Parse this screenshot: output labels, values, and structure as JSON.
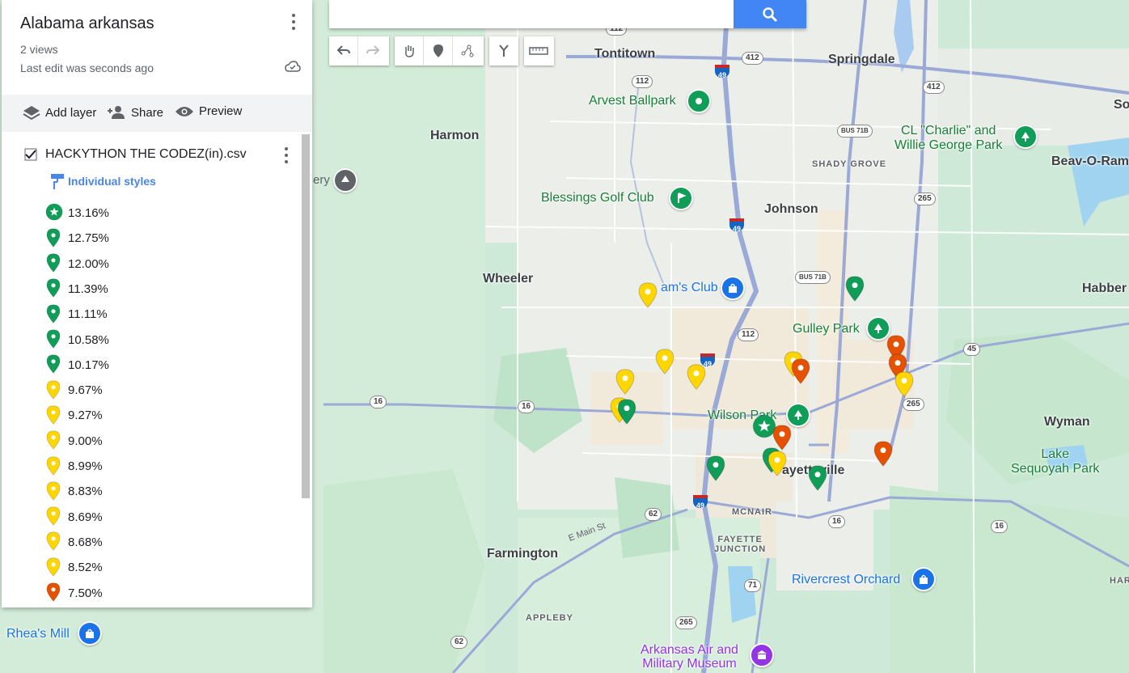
{
  "map": {
    "town_labels": [
      "Tontitown",
      "Springdale",
      "Harmon",
      "Johnson",
      "Wheeler",
      "Farmington",
      "Wyman",
      "Habber",
      "Beav-O-Ram",
      "So"
    ],
    "neighborhood_labels": [
      "SHADY GROVE",
      "MCNAIR",
      "FAYETTE\nJUNCTION",
      "APPLEBY",
      "HAR"
    ],
    "poi_labels": {
      "arvest": "Arvest Ballpark",
      "clcharlie": "CL \"Charlie\" and\nWillie George Park",
      "blessings": "Blessings Golf Club",
      "sams": "am's Club",
      "gulley": "Gulley Park",
      "wilson": "Wilson Park",
      "fayetteville": "ayetteville",
      "lake": "Lake\nSequoyah Park",
      "rivercrest": "Rivercrest Orchard",
      "rheas": "Rhea's Mill",
      "museum": "Arkansas Air and\nMilitary Museum",
      "ery": "ery",
      "mainst": "E Main St"
    },
    "route_shields": [
      "112",
      "412",
      "49",
      "112",
      "412",
      "BUS 71B",
      "265",
      "49",
      "BUS 71B",
      "112",
      "49",
      "45",
      "16",
      "16",
      "265",
      "62",
      "49",
      "16",
      "16",
      "71",
      "265",
      "62"
    ]
  },
  "panel": {
    "title": "Alabama arkansas",
    "views": "2 views",
    "last_edit": "Last edit was seconds ago",
    "toolbar": {
      "add_layer": "Add layer",
      "share": "Share",
      "preview": "Preview"
    },
    "layer": {
      "name": "HACKYTHON THE CODEZ(in).csv",
      "style_link": "Individual styles",
      "legend": [
        {
          "label": "13.16%",
          "color": "#0f9d58",
          "icon": "star"
        },
        {
          "label": "12.75%",
          "color": "#0f9d58",
          "icon": "pin"
        },
        {
          "label": "12.00%",
          "color": "#0f9d58",
          "icon": "pin"
        },
        {
          "label": "11.39%",
          "color": "#0f9d58",
          "icon": "pin"
        },
        {
          "label": "11.11%",
          "color": "#0f9d58",
          "icon": "pin"
        },
        {
          "label": "10.58%",
          "color": "#0f9d58",
          "icon": "pin"
        },
        {
          "label": "10.17%",
          "color": "#0f9d58",
          "icon": "pin"
        },
        {
          "label": "9.67%",
          "color": "#ffd600",
          "icon": "pin"
        },
        {
          "label": "9.27%",
          "color": "#ffd600",
          "icon": "pin"
        },
        {
          "label": "9.00%",
          "color": "#ffd600",
          "icon": "pin"
        },
        {
          "label": "8.99%",
          "color": "#ffd600",
          "icon": "pin"
        },
        {
          "label": "8.83%",
          "color": "#ffd600",
          "icon": "pin"
        },
        {
          "label": "8.69%",
          "color": "#ffd600",
          "icon": "pin"
        },
        {
          "label": "8.68%",
          "color": "#ffd600",
          "icon": "pin"
        },
        {
          "label": "8.52%",
          "color": "#ffd600",
          "icon": "pin"
        },
        {
          "label": "7.50%",
          "color": "#e65100",
          "icon": "pin"
        }
      ]
    }
  },
  "search": {
    "placeholder": ""
  },
  "colors": {
    "green_pin": "#0f9d58",
    "yellow_pin": "#ffd600",
    "orange_pin": "#e65100",
    "search_blue": "#4285f4",
    "style_link": "#4a86e8"
  }
}
